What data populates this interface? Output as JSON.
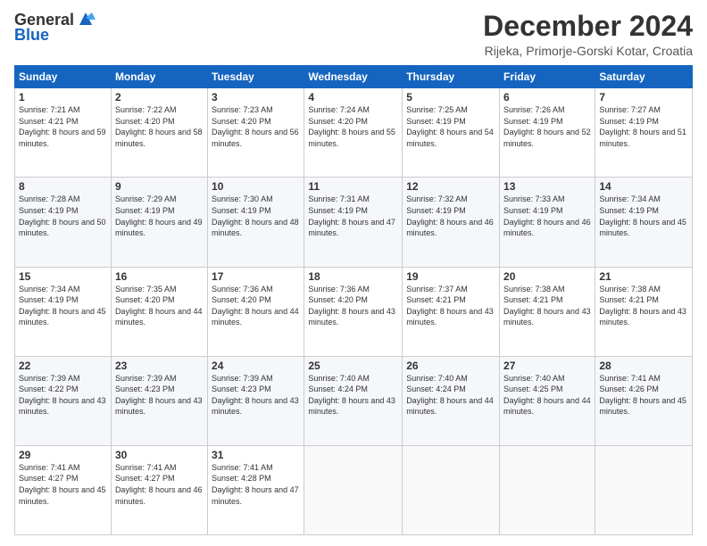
{
  "header": {
    "logo_general": "General",
    "logo_blue": "Blue",
    "month_title": "December 2024",
    "location": "Rijeka, Primorje-Gorski Kotar, Croatia"
  },
  "days_of_week": [
    "Sunday",
    "Monday",
    "Tuesday",
    "Wednesday",
    "Thursday",
    "Friday",
    "Saturday"
  ],
  "weeks": [
    [
      {
        "day": "1",
        "sunrise": "7:21 AM",
        "sunset": "4:21 PM",
        "daylight": "8 hours and 59 minutes."
      },
      {
        "day": "2",
        "sunrise": "7:22 AM",
        "sunset": "4:20 PM",
        "daylight": "8 hours and 58 minutes."
      },
      {
        "day": "3",
        "sunrise": "7:23 AM",
        "sunset": "4:20 PM",
        "daylight": "8 hours and 56 minutes."
      },
      {
        "day": "4",
        "sunrise": "7:24 AM",
        "sunset": "4:20 PM",
        "daylight": "8 hours and 55 minutes."
      },
      {
        "day": "5",
        "sunrise": "7:25 AM",
        "sunset": "4:19 PM",
        "daylight": "8 hours and 54 minutes."
      },
      {
        "day": "6",
        "sunrise": "7:26 AM",
        "sunset": "4:19 PM",
        "daylight": "8 hours and 52 minutes."
      },
      {
        "day": "7",
        "sunrise": "7:27 AM",
        "sunset": "4:19 PM",
        "daylight": "8 hours and 51 minutes."
      }
    ],
    [
      {
        "day": "8",
        "sunrise": "7:28 AM",
        "sunset": "4:19 PM",
        "daylight": "8 hours and 50 minutes."
      },
      {
        "day": "9",
        "sunrise": "7:29 AM",
        "sunset": "4:19 PM",
        "daylight": "8 hours and 49 minutes."
      },
      {
        "day": "10",
        "sunrise": "7:30 AM",
        "sunset": "4:19 PM",
        "daylight": "8 hours and 48 minutes."
      },
      {
        "day": "11",
        "sunrise": "7:31 AM",
        "sunset": "4:19 PM",
        "daylight": "8 hours and 47 minutes."
      },
      {
        "day": "12",
        "sunrise": "7:32 AM",
        "sunset": "4:19 PM",
        "daylight": "8 hours and 46 minutes."
      },
      {
        "day": "13",
        "sunrise": "7:33 AM",
        "sunset": "4:19 PM",
        "daylight": "8 hours and 46 minutes."
      },
      {
        "day": "14",
        "sunrise": "7:34 AM",
        "sunset": "4:19 PM",
        "daylight": "8 hours and 45 minutes."
      }
    ],
    [
      {
        "day": "15",
        "sunrise": "7:34 AM",
        "sunset": "4:19 PM",
        "daylight": "8 hours and 45 minutes."
      },
      {
        "day": "16",
        "sunrise": "7:35 AM",
        "sunset": "4:20 PM",
        "daylight": "8 hours and 44 minutes."
      },
      {
        "day": "17",
        "sunrise": "7:36 AM",
        "sunset": "4:20 PM",
        "daylight": "8 hours and 44 minutes."
      },
      {
        "day": "18",
        "sunrise": "7:36 AM",
        "sunset": "4:20 PM",
        "daylight": "8 hours and 43 minutes."
      },
      {
        "day": "19",
        "sunrise": "7:37 AM",
        "sunset": "4:21 PM",
        "daylight": "8 hours and 43 minutes."
      },
      {
        "day": "20",
        "sunrise": "7:38 AM",
        "sunset": "4:21 PM",
        "daylight": "8 hours and 43 minutes."
      },
      {
        "day": "21",
        "sunrise": "7:38 AM",
        "sunset": "4:21 PM",
        "daylight": "8 hours and 43 minutes."
      }
    ],
    [
      {
        "day": "22",
        "sunrise": "7:39 AM",
        "sunset": "4:22 PM",
        "daylight": "8 hours and 43 minutes."
      },
      {
        "day": "23",
        "sunrise": "7:39 AM",
        "sunset": "4:23 PM",
        "daylight": "8 hours and 43 minutes."
      },
      {
        "day": "24",
        "sunrise": "7:39 AM",
        "sunset": "4:23 PM",
        "daylight": "8 hours and 43 minutes."
      },
      {
        "day": "25",
        "sunrise": "7:40 AM",
        "sunset": "4:24 PM",
        "daylight": "8 hours and 43 minutes."
      },
      {
        "day": "26",
        "sunrise": "7:40 AM",
        "sunset": "4:24 PM",
        "daylight": "8 hours and 44 minutes."
      },
      {
        "day": "27",
        "sunrise": "7:40 AM",
        "sunset": "4:25 PM",
        "daylight": "8 hours and 44 minutes."
      },
      {
        "day": "28",
        "sunrise": "7:41 AM",
        "sunset": "4:26 PM",
        "daylight": "8 hours and 45 minutes."
      }
    ],
    [
      {
        "day": "29",
        "sunrise": "7:41 AM",
        "sunset": "4:27 PM",
        "daylight": "8 hours and 45 minutes."
      },
      {
        "day": "30",
        "sunrise": "7:41 AM",
        "sunset": "4:27 PM",
        "daylight": "8 hours and 46 minutes."
      },
      {
        "day": "31",
        "sunrise": "7:41 AM",
        "sunset": "4:28 PM",
        "daylight": "8 hours and 47 minutes."
      },
      null,
      null,
      null,
      null
    ]
  ]
}
